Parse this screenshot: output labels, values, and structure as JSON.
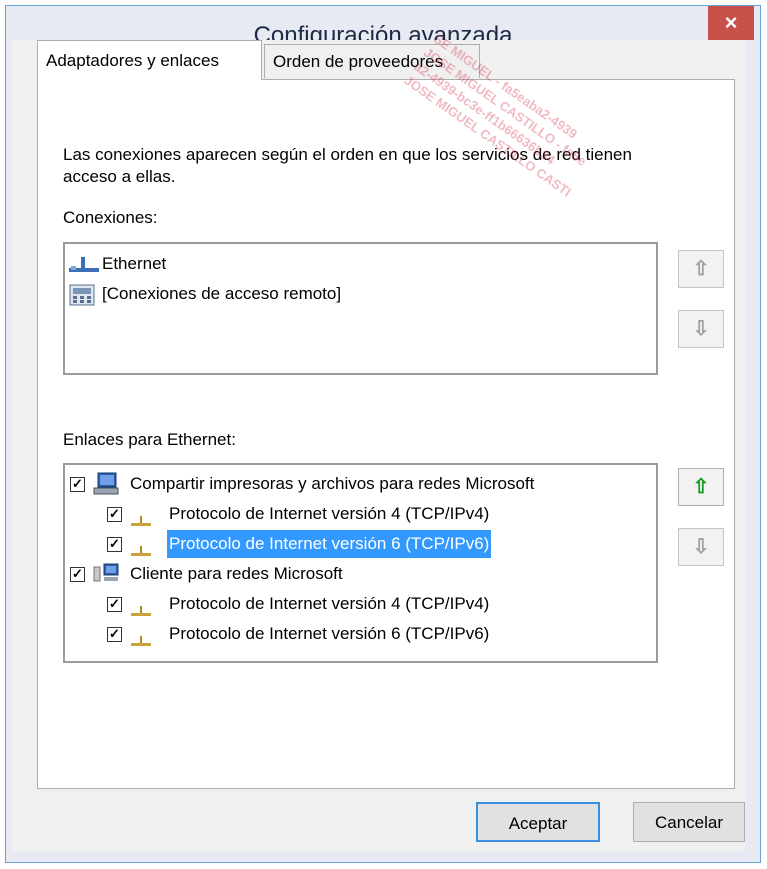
{
  "window": {
    "title": "Configuración avanzada",
    "close_glyph": "×"
  },
  "tabs": [
    {
      "label": "Adaptadores y enlaces",
      "active": true
    },
    {
      "label": "Orden de proveedores",
      "active": false
    }
  ],
  "description": "Las conexiones aparecen según el orden en que los servicios de red tienen acceso a ellas.",
  "connections": {
    "label": "Conexiones:",
    "items": [
      {
        "label": "Ethernet",
        "icon": "ethernet-icon"
      },
      {
        "label": "[Conexiones de acceso remoto]",
        "icon": "remote-access-icon"
      }
    ],
    "up_glyph": "⇧",
    "down_glyph": "⇩"
  },
  "bindings": {
    "label": "Enlaces para Ethernet:",
    "items": [
      {
        "label": "Compartir impresoras y archivos para redes Microsoft",
        "checked": true,
        "level": 0,
        "icon": "file-printer-sharing-icon"
      },
      {
        "label": "Protocolo de Internet versión 4 (TCP/IPv4)",
        "checked": true,
        "level": 1,
        "icon": "protocol-icon"
      },
      {
        "label": "Protocolo de Internet versión 6 (TCP/IPv6)",
        "checked": true,
        "level": 1,
        "icon": "protocol-icon",
        "selected": true
      },
      {
        "label": "Cliente para redes Microsoft",
        "checked": true,
        "level": 0,
        "icon": "network-client-icon"
      },
      {
        "label": "Protocolo de Internet versión 4 (TCP/IPv4)",
        "checked": true,
        "level": 1,
        "icon": "protocol-icon"
      },
      {
        "label": "Protocolo de Internet versión 6 (TCP/IPv6)",
        "checked": true,
        "level": 1,
        "icon": "protocol-icon"
      }
    ],
    "up_glyph": "⇧",
    "down_glyph": "⇩"
  },
  "buttons": {
    "ok": "Aceptar",
    "cancel": "Cancelar"
  },
  "watermark": [
    "SE MIGUEL - fa5eaba2-4939",
    "JOSE MIGUEL CASTILLO - fa5e",
    "a2-4939-bc3e-ff1b66636b34",
    "JOSE MIGUEL CASTILLO CASTI"
  ],
  "colors": {
    "selection": "#3399ff",
    "close_button": "#c7504b",
    "up_arrow_active": "#129c1a"
  }
}
